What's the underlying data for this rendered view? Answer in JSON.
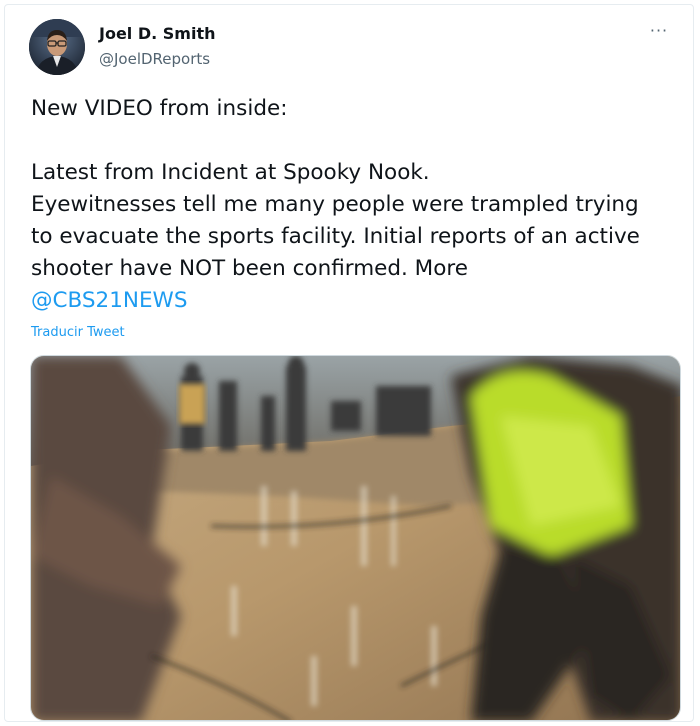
{
  "tweet": {
    "author_name": "Joel D. Smith",
    "author_handle": "@JoelDReports",
    "more_glyph": "···",
    "text_line1": "New VIDEO from inside:",
    "text_body": "Latest from Incident at Spooky Nook.\nEyewitnesses tell me many people were trampled trying\nto evacuate the sports facility. Initial reports of an active\nshooter have NOT been confirmed. More",
    "mention": "@CBS21NEWS",
    "translate_label": "Traducir Tweet"
  },
  "colors": {
    "link": "#1d9bf0",
    "text": "#0f1419",
    "secondary": "#536471"
  },
  "icons": {
    "more": "more-options-icon"
  }
}
